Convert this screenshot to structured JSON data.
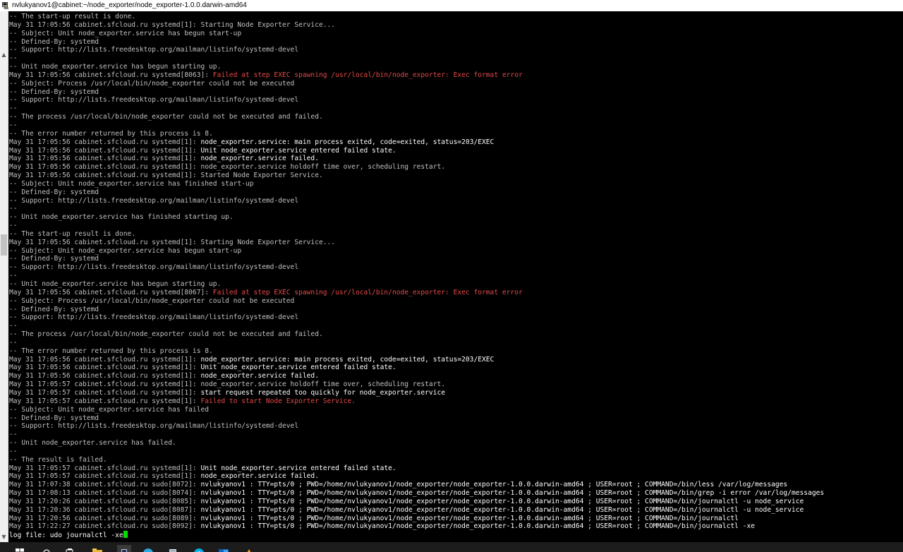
{
  "window": {
    "title": "nvlukyanov1@cabinet:~/node_exporter/node_exporter-1.0.0.darwin-amd64"
  },
  "colors": {
    "background": "#000000",
    "text_default": "#c0c0c0",
    "text_bright": "#ffffff",
    "text_error": "#e64848",
    "cursor": "#00e000"
  },
  "terminal": {
    "lines": [
      {
        "prefix": "",
        "msg": "-- The start-up result is done.",
        "color": "gray"
      },
      {
        "prefix": "May 31 17:05:56 cabinet.sfcloud.ru systemd[1]: ",
        "msg": "Starting Node Exporter Service...",
        "color": "gray"
      },
      {
        "prefix": "",
        "msg": "-- Subject: Unit node_exporter.service has begun start-up",
        "color": "gray"
      },
      {
        "prefix": "",
        "msg": "-- Defined-By: systemd",
        "color": "gray"
      },
      {
        "prefix": "",
        "msg": "-- Support: http://lists.freedesktop.org/mailman/listinfo/systemd-devel",
        "color": "gray"
      },
      {
        "prefix": "",
        "msg": "--",
        "color": "gray"
      },
      {
        "prefix": "",
        "msg": "-- Unit node_exporter.service has begun starting up.",
        "color": "gray"
      },
      {
        "prefix": "May 31 17:05:56 cabinet.sfcloud.ru systemd[8063]: ",
        "msg": "Failed at step EXEC spawning /usr/local/bin/node_exporter: Exec format error",
        "color": "red"
      },
      {
        "prefix": "",
        "msg": "-- Subject: Process /usr/local/bin/node_exporter could not be executed",
        "color": "gray"
      },
      {
        "prefix": "",
        "msg": "-- Defined-By: systemd",
        "color": "gray"
      },
      {
        "prefix": "",
        "msg": "-- Support: http://lists.freedesktop.org/mailman/listinfo/systemd-devel",
        "color": "gray"
      },
      {
        "prefix": "",
        "msg": "--",
        "color": "gray"
      },
      {
        "prefix": "",
        "msg": "-- The process /usr/local/bin/node_exporter could not be executed and failed.",
        "color": "gray"
      },
      {
        "prefix": "",
        "msg": "--",
        "color": "gray"
      },
      {
        "prefix": "",
        "msg": "-- The error number returned by this process is 8.",
        "color": "gray"
      },
      {
        "prefix": "May 31 17:05:56 cabinet.sfcloud.ru systemd[1]: ",
        "msg": "node_exporter.service: main process exited, code=exited, status=203/EXEC",
        "color": "white"
      },
      {
        "prefix": "May 31 17:05:56 cabinet.sfcloud.ru systemd[1]: ",
        "msg": "Unit node_exporter.service entered failed state.",
        "color": "white"
      },
      {
        "prefix": "May 31 17:05:56 cabinet.sfcloud.ru systemd[1]: ",
        "msg": "node_exporter.service failed.",
        "color": "white"
      },
      {
        "prefix": "May 31 17:05:56 cabinet.sfcloud.ru systemd[1]: ",
        "msg": "node_exporter.service holdoff time over, scheduling restart.",
        "color": "gray"
      },
      {
        "prefix": "May 31 17:05:56 cabinet.sfcloud.ru systemd[1]: ",
        "msg": "Started Node Exporter Service.",
        "color": "gray"
      },
      {
        "prefix": "",
        "msg": "-- Subject: Unit node_exporter.service has finished start-up",
        "color": "gray"
      },
      {
        "prefix": "",
        "msg": "-- Defined-By: systemd",
        "color": "gray"
      },
      {
        "prefix": "",
        "msg": "-- Support: http://lists.freedesktop.org/mailman/listinfo/systemd-devel",
        "color": "gray"
      },
      {
        "prefix": "",
        "msg": "--",
        "color": "gray"
      },
      {
        "prefix": "",
        "msg": "-- Unit node_exporter.service has finished starting up.",
        "color": "gray"
      },
      {
        "prefix": "",
        "msg": "--",
        "color": "gray"
      },
      {
        "prefix": "",
        "msg": "-- The start-up result is done.",
        "color": "gray"
      },
      {
        "prefix": "May 31 17:05:56 cabinet.sfcloud.ru systemd[1]: ",
        "msg": "Starting Node Exporter Service...",
        "color": "gray"
      },
      {
        "prefix": "",
        "msg": "-- Subject: Unit node_exporter.service has begun start-up",
        "color": "gray"
      },
      {
        "prefix": "",
        "msg": "-- Defined-By: systemd",
        "color": "gray"
      },
      {
        "prefix": "",
        "msg": "-- Support: http://lists.freedesktop.org/mailman/listinfo/systemd-devel",
        "color": "gray"
      },
      {
        "prefix": "",
        "msg": "--",
        "color": "gray"
      },
      {
        "prefix": "",
        "msg": "-- Unit node_exporter.service has begun starting up.",
        "color": "gray"
      },
      {
        "prefix": "May 31 17:05:56 cabinet.sfcloud.ru systemd[8067]: ",
        "msg": "Failed at step EXEC spawning /usr/local/bin/node_exporter: Exec format error",
        "color": "red"
      },
      {
        "prefix": "",
        "msg": "-- Subject: Process /usr/local/bin/node_exporter could not be executed",
        "color": "gray"
      },
      {
        "prefix": "",
        "msg": "-- Defined-By: systemd",
        "color": "gray"
      },
      {
        "prefix": "",
        "msg": "-- Support: http://lists.freedesktop.org/mailman/listinfo/systemd-devel",
        "color": "gray"
      },
      {
        "prefix": "",
        "msg": "--",
        "color": "gray"
      },
      {
        "prefix": "",
        "msg": "-- The process /usr/local/bin/node_exporter could not be executed and failed.",
        "color": "gray"
      },
      {
        "prefix": "",
        "msg": "--",
        "color": "gray"
      },
      {
        "prefix": "",
        "msg": "-- The error number returned by this process is 8.",
        "color": "gray"
      },
      {
        "prefix": "May 31 17:05:56 cabinet.sfcloud.ru systemd[1]: ",
        "msg": "node_exporter.service: main process exited, code=exited, status=203/EXEC",
        "color": "white"
      },
      {
        "prefix": "May 31 17:05:56 cabinet.sfcloud.ru systemd[1]: ",
        "msg": "Unit node_exporter.service entered failed state.",
        "color": "white"
      },
      {
        "prefix": "May 31 17:05:56 cabinet.sfcloud.ru systemd[1]: ",
        "msg": "node_exporter.service failed.",
        "color": "white"
      },
      {
        "prefix": "May 31 17:05:57 cabinet.sfcloud.ru systemd[1]: ",
        "msg": "node_exporter.service holdoff time over, scheduling restart.",
        "color": "gray"
      },
      {
        "prefix": "May 31 17:05:57 cabinet.sfcloud.ru systemd[1]: ",
        "msg": "start request repeated too quickly for node_exporter.service",
        "color": "white"
      },
      {
        "prefix": "May 31 17:05:57 cabinet.sfcloud.ru systemd[1]: ",
        "msg": "Failed to start Node Exporter Service.",
        "color": "red"
      },
      {
        "prefix": "",
        "msg": "-- Subject: Unit node_exporter.service has failed",
        "color": "gray"
      },
      {
        "prefix": "",
        "msg": "-- Defined-By: systemd",
        "color": "gray"
      },
      {
        "prefix": "",
        "msg": "-- Support: http://lists.freedesktop.org/mailman/listinfo/systemd-devel",
        "color": "gray"
      },
      {
        "prefix": "",
        "msg": "--",
        "color": "gray"
      },
      {
        "prefix": "",
        "msg": "-- Unit node_exporter.service has failed.",
        "color": "gray"
      },
      {
        "prefix": "",
        "msg": "--",
        "color": "gray"
      },
      {
        "prefix": "",
        "msg": "-- The result is failed.",
        "color": "gray"
      },
      {
        "prefix": "May 31 17:05:57 cabinet.sfcloud.ru systemd[1]: ",
        "msg": "Unit node_exporter.service entered failed state.",
        "color": "white"
      },
      {
        "prefix": "May 31 17:05:57 cabinet.sfcloud.ru systemd[1]: ",
        "msg": "node_exporter.service failed.",
        "color": "white"
      },
      {
        "prefix": "May 31 17:07:38 cabinet.sfcloud.ru sudo[8072]: ",
        "msg": "nvlukyanov1 : TTY=pts/0 ; PWD=/home/nvlukyanov1/node_exporter/node_exporter-1.0.0.darwin-amd64 ; USER=root ; COMMAND=/bin/less /var/log/messages",
        "color": "white"
      },
      {
        "prefix": "May 31 17:08:13 cabinet.sfcloud.ru sudo[8074]: ",
        "msg": "nvlukyanov1 : TTY=pts/0 ; PWD=/home/nvlukyanov1/node_exporter/node_exporter-1.0.0.darwin-amd64 ; USER=root ; COMMAND=/bin/grep -i error /var/log/messages",
        "color": "white"
      },
      {
        "prefix": "May 31 17:20:26 cabinet.sfcloud.ru sudo[8085]: ",
        "msg": "nvlukyanov1 : TTY=pts/0 ; PWD=/home/nvlukyanov1/node_exporter/node_exporter-1.0.0.darwin-amd64 ; USER=root ; COMMAND=/bin/journalctl -u node_service",
        "color": "white"
      },
      {
        "prefix": "May 31 17:20:36 cabinet.sfcloud.ru sudo[8087]: ",
        "msg": "nvlukyanov1 : TTY=pts/0 ; PWD=/home/nvlukyanov1/node_exporter/node_exporter-1.0.0.darwin-amd64 ; USER=root ; COMMAND=/bin/journalctl -u node_service",
        "color": "white"
      },
      {
        "prefix": "May 31 17:20:56 cabinet.sfcloud.ru sudo[8089]: ",
        "msg": "nvlukyanov1 : TTY=pts/0 ; PWD=/home/nvlukyanov1/node_exporter/node_exporter-1.0.0.darwin-amd64 ; USER=root ; COMMAND=/bin/journalctl",
        "color": "white"
      },
      {
        "prefix": "May 31 17:22:27 cabinet.sfcloud.ru sudo[8092]: ",
        "msg": "nvlukyanov1 : TTY=pts/0 ; PWD=/home/nvlukyanov1/node_exporter/node_exporter-1.0.0.darwin-amd64 ; USER=root ; COMMAND=/bin/journalctl -xe",
        "color": "white"
      }
    ],
    "prompt": "log file: udo journalctl -xe"
  },
  "scrollbar": {
    "up_icon": "triangle-up",
    "down_icon": "triangle-down"
  },
  "taskbar": {
    "icons": [
      "windows-start-icon",
      "search-icon",
      "task-view-icon",
      "file-explorer-icon",
      "putty-icon",
      "telegram-icon",
      "notepad-icon",
      "skype-icon",
      "outlook-icon",
      "paint-icon"
    ]
  }
}
